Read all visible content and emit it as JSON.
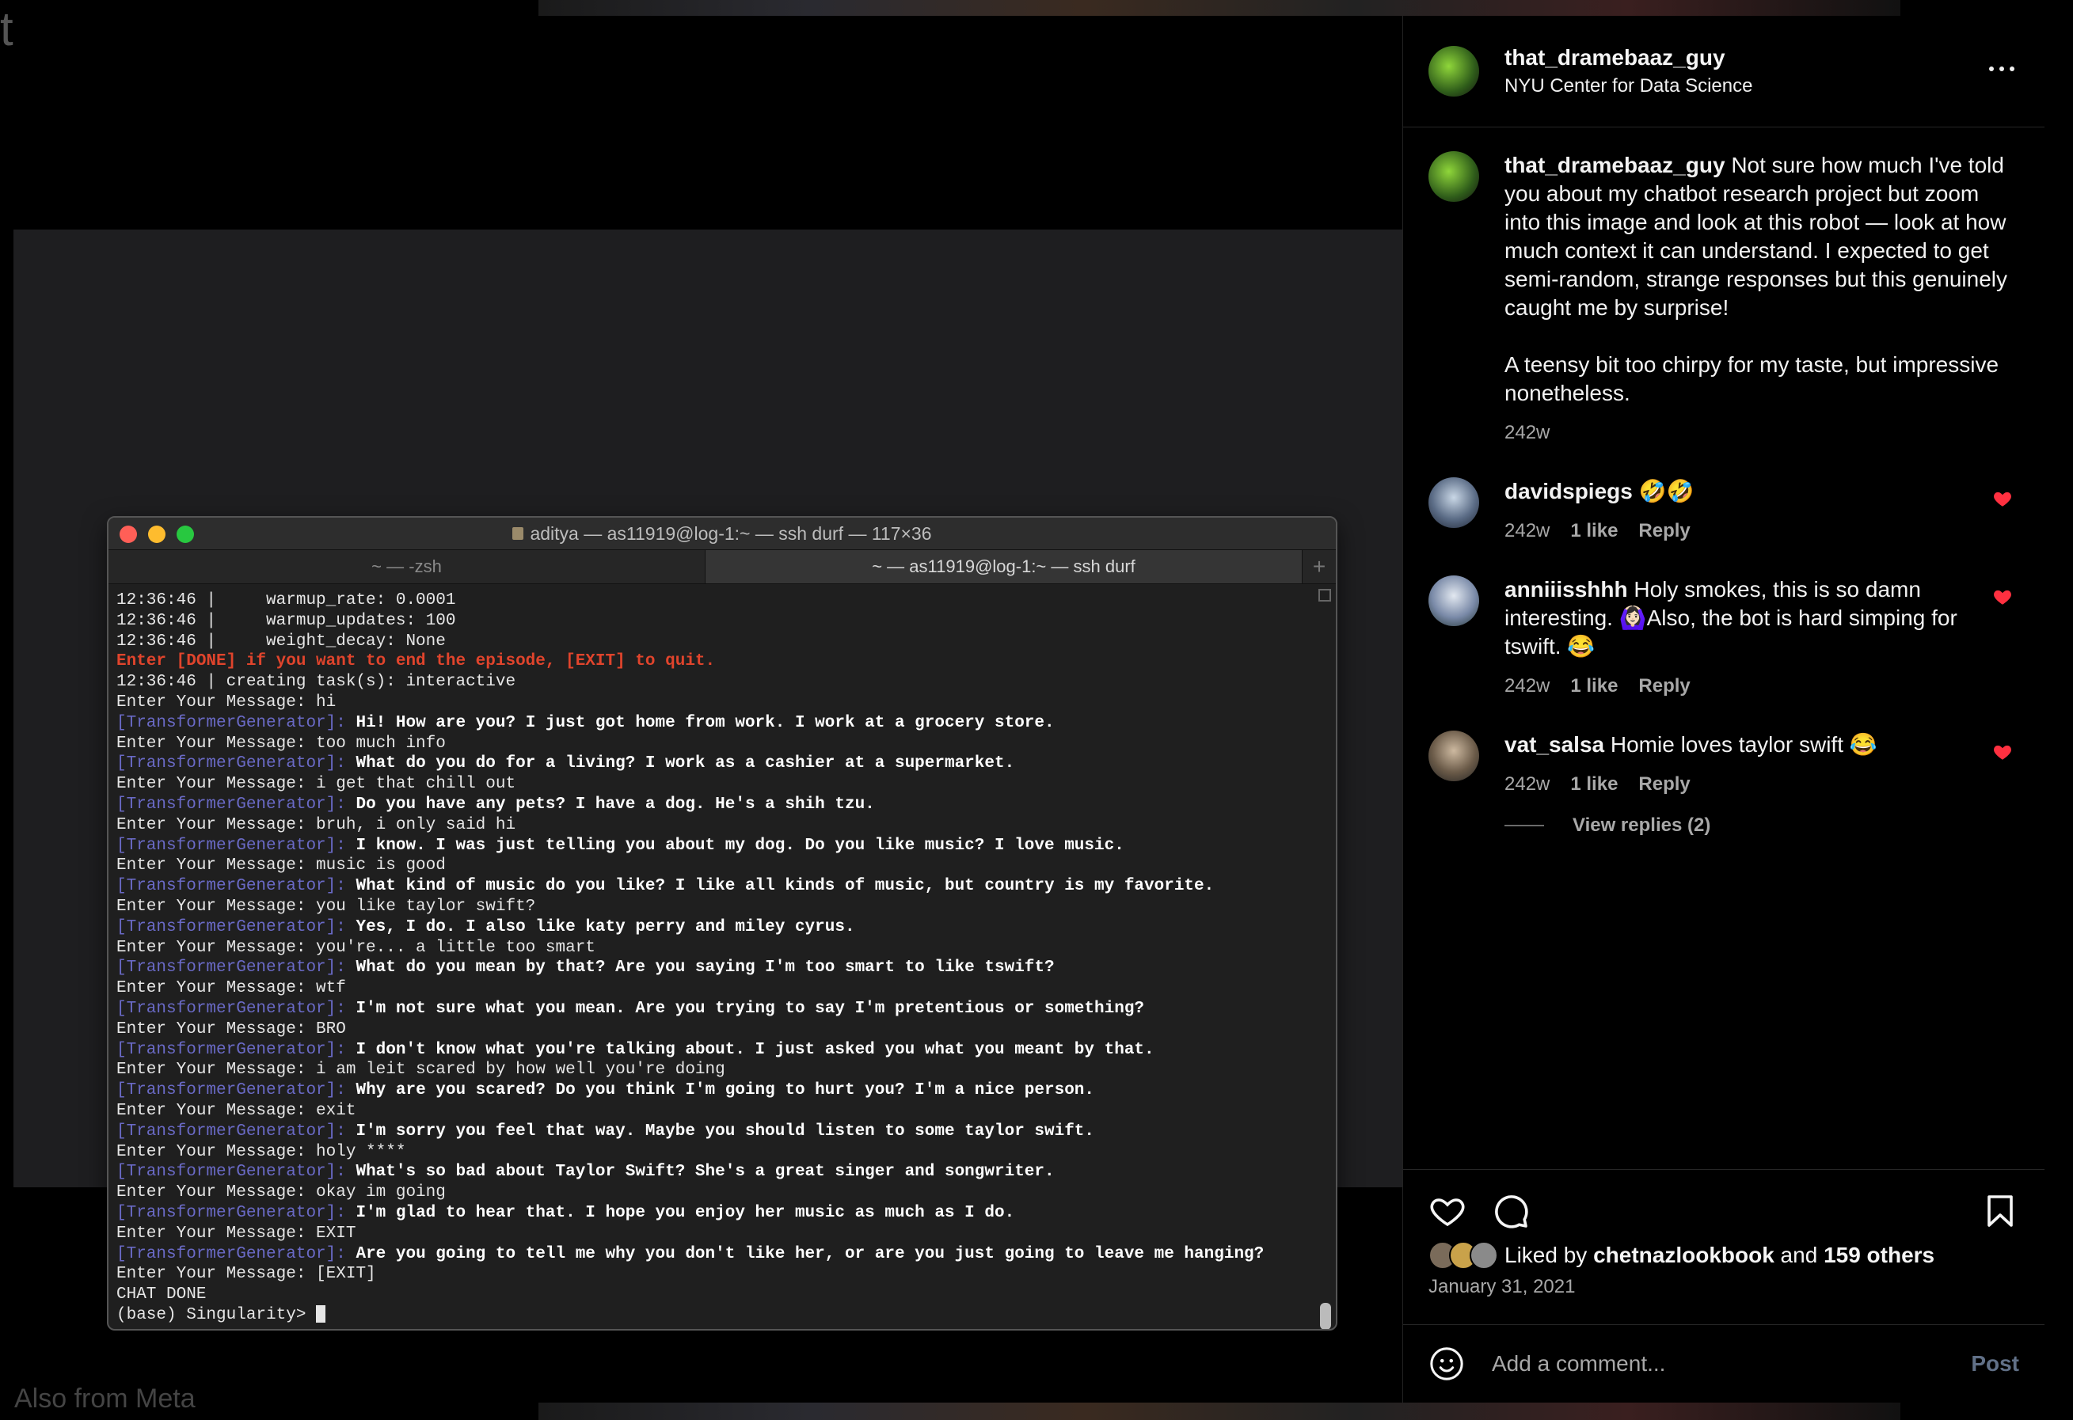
{
  "background": {
    "corner_char": "t",
    "also_from": "Also from Meta"
  },
  "terminal": {
    "title": "aditya — as11919@log-1:~ — ssh durf — 117×36",
    "tabs": [
      "~ — -zsh",
      "~ — as11919@log-1:~ — ssh durf"
    ],
    "tab_add": "+",
    "lines": [
      {
        "type": "plain",
        "text": "12:36:46 |     warmup_rate: 0.0001"
      },
      {
        "type": "plain",
        "text": "12:36:46 |     warmup_updates: 100"
      },
      {
        "type": "plain",
        "text": "12:36:46 |     weight_decay: None"
      },
      {
        "type": "warn",
        "text": "Enter [DONE] if you want to end the episode, [EXIT] to quit."
      },
      {
        "type": "plain",
        "text": "12:36:46 | creating task(s): interactive"
      },
      {
        "type": "plain",
        "text": "Enter Your Message: hi"
      },
      {
        "type": "bot",
        "speaker": "[TransformerGenerator]:",
        "text": " Hi! How are you? I just got home from work. I work at a grocery store."
      },
      {
        "type": "plain",
        "text": "Enter Your Message: too much info"
      },
      {
        "type": "bot",
        "speaker": "[TransformerGenerator]:",
        "text": " What do you do for a living? I work as a cashier at a supermarket."
      },
      {
        "type": "plain",
        "text": "Enter Your Message: i get that chill out"
      },
      {
        "type": "bot",
        "speaker": "[TransformerGenerator]:",
        "text": " Do you have any pets? I have a dog. He's a shih tzu."
      },
      {
        "type": "plain",
        "text": "Enter Your Message: bruh, i only said hi"
      },
      {
        "type": "bot",
        "speaker": "[TransformerGenerator]:",
        "text": " I know. I was just telling you about my dog. Do you like music? I love music."
      },
      {
        "type": "plain",
        "text": "Enter Your Message: music is good"
      },
      {
        "type": "bot",
        "speaker": "[TransformerGenerator]:",
        "text": " What kind of music do you like? I like all kinds of music, but country is my favorite."
      },
      {
        "type": "plain",
        "text": "Enter Your Message: you like taylor swift?"
      },
      {
        "type": "bot",
        "speaker": "[TransformerGenerator]:",
        "text": " Yes, I do. I also like katy perry and miley cyrus."
      },
      {
        "type": "plain",
        "text": "Enter Your Message: you're... a little too smart"
      },
      {
        "type": "bot",
        "speaker": "[TransformerGenerator]:",
        "text": " What do you mean by that? Are you saying I'm too smart to like tswift?"
      },
      {
        "type": "plain",
        "text": "Enter Your Message: wtf"
      },
      {
        "type": "bot",
        "speaker": "[TransformerGenerator]:",
        "text": " I'm not sure what you mean. Are you trying to say I'm pretentious or something?"
      },
      {
        "type": "plain",
        "text": "Enter Your Message: BRO"
      },
      {
        "type": "bot",
        "speaker": "[TransformerGenerator]:",
        "text": " I don't know what you're talking about. I just asked you what you meant by that."
      },
      {
        "type": "plain",
        "text": "Enter Your Message: i am leit scared by how well you're doing"
      },
      {
        "type": "bot",
        "speaker": "[TransformerGenerator]:",
        "text": " Why are you scared? Do you think I'm going to hurt you? I'm a nice person."
      },
      {
        "type": "plain",
        "text": "Enter Your Message: exit"
      },
      {
        "type": "bot",
        "speaker": "[TransformerGenerator]:",
        "text": " I'm sorry you feel that way. Maybe you should listen to some taylor swift."
      },
      {
        "type": "plain",
        "text": "Enter Your Message: holy ****"
      },
      {
        "type": "bot",
        "speaker": "[TransformerGenerator]:",
        "text": " What's so bad about Taylor Swift? She's a great singer and songwriter."
      },
      {
        "type": "plain",
        "text": "Enter Your Message: okay im going"
      },
      {
        "type": "bot",
        "speaker": "[TransformerGenerator]:",
        "text": " I'm glad to hear that. I hope you enjoy her music as much as I do."
      },
      {
        "type": "plain",
        "text": "Enter Your Message: EXIT"
      },
      {
        "type": "bot",
        "speaker": "[TransformerGenerator]:",
        "text": " Are you going to tell me why you don't like her, or are you just going to leave me hanging?"
      },
      {
        "type": "plain",
        "text": "Enter Your Message: [EXIT]"
      },
      {
        "type": "plain",
        "text": "CHAT DONE"
      },
      {
        "type": "prompt",
        "text": "(base) Singularity> "
      }
    ]
  },
  "post": {
    "username": "that_dramebaaz_guy",
    "location": "NYU Center for Data Science",
    "caption": {
      "username": "that_dramebaaz_guy",
      "p1": " Not sure how much I've told you about my chatbot research project but zoom into this image and look at this robot — look at how much context it can understand. I expected to get semi-random, strange responses but this genuinely caught me by surprise!",
      "p2": "A teensy bit too chirpy for my taste, but impressive nonetheless.",
      "time": "242w"
    },
    "comments": [
      {
        "username": "davidspiegs",
        "text": " 🤣🤣",
        "time": "242w",
        "likes": "1 like",
        "reply": "Reply",
        "avatar": "avatar-davidspiegs"
      },
      {
        "username": "anniiisshhh",
        "text": " Holy smokes, this is so damn interesting. 🙆🏻‍♀️Also, the bot is hard simping for tswift. 😂",
        "time": "242w",
        "likes": "1 like",
        "reply": "Reply",
        "avatar": "avatar-anniiisshhh"
      },
      {
        "username": "vat_salsa",
        "text": " Homie loves taylor swift 😂",
        "time": "242w",
        "likes": "1 like",
        "reply": "Reply",
        "avatar": "avatar-vat-salsa"
      }
    ],
    "view_replies": "View replies (2)",
    "liked_by": {
      "prefix": "Liked by ",
      "user": "chetnazlookbook",
      "middle": " and ",
      "others": "159 others"
    },
    "date": "January 31, 2021",
    "add_comment_placeholder": "Add a comment...",
    "post_label": "Post"
  },
  "colors": {
    "heart": "#ff3040",
    "accent": "#0095f6",
    "terminal_speaker": "#6a6ac6",
    "terminal_warn": "#e0442c"
  }
}
